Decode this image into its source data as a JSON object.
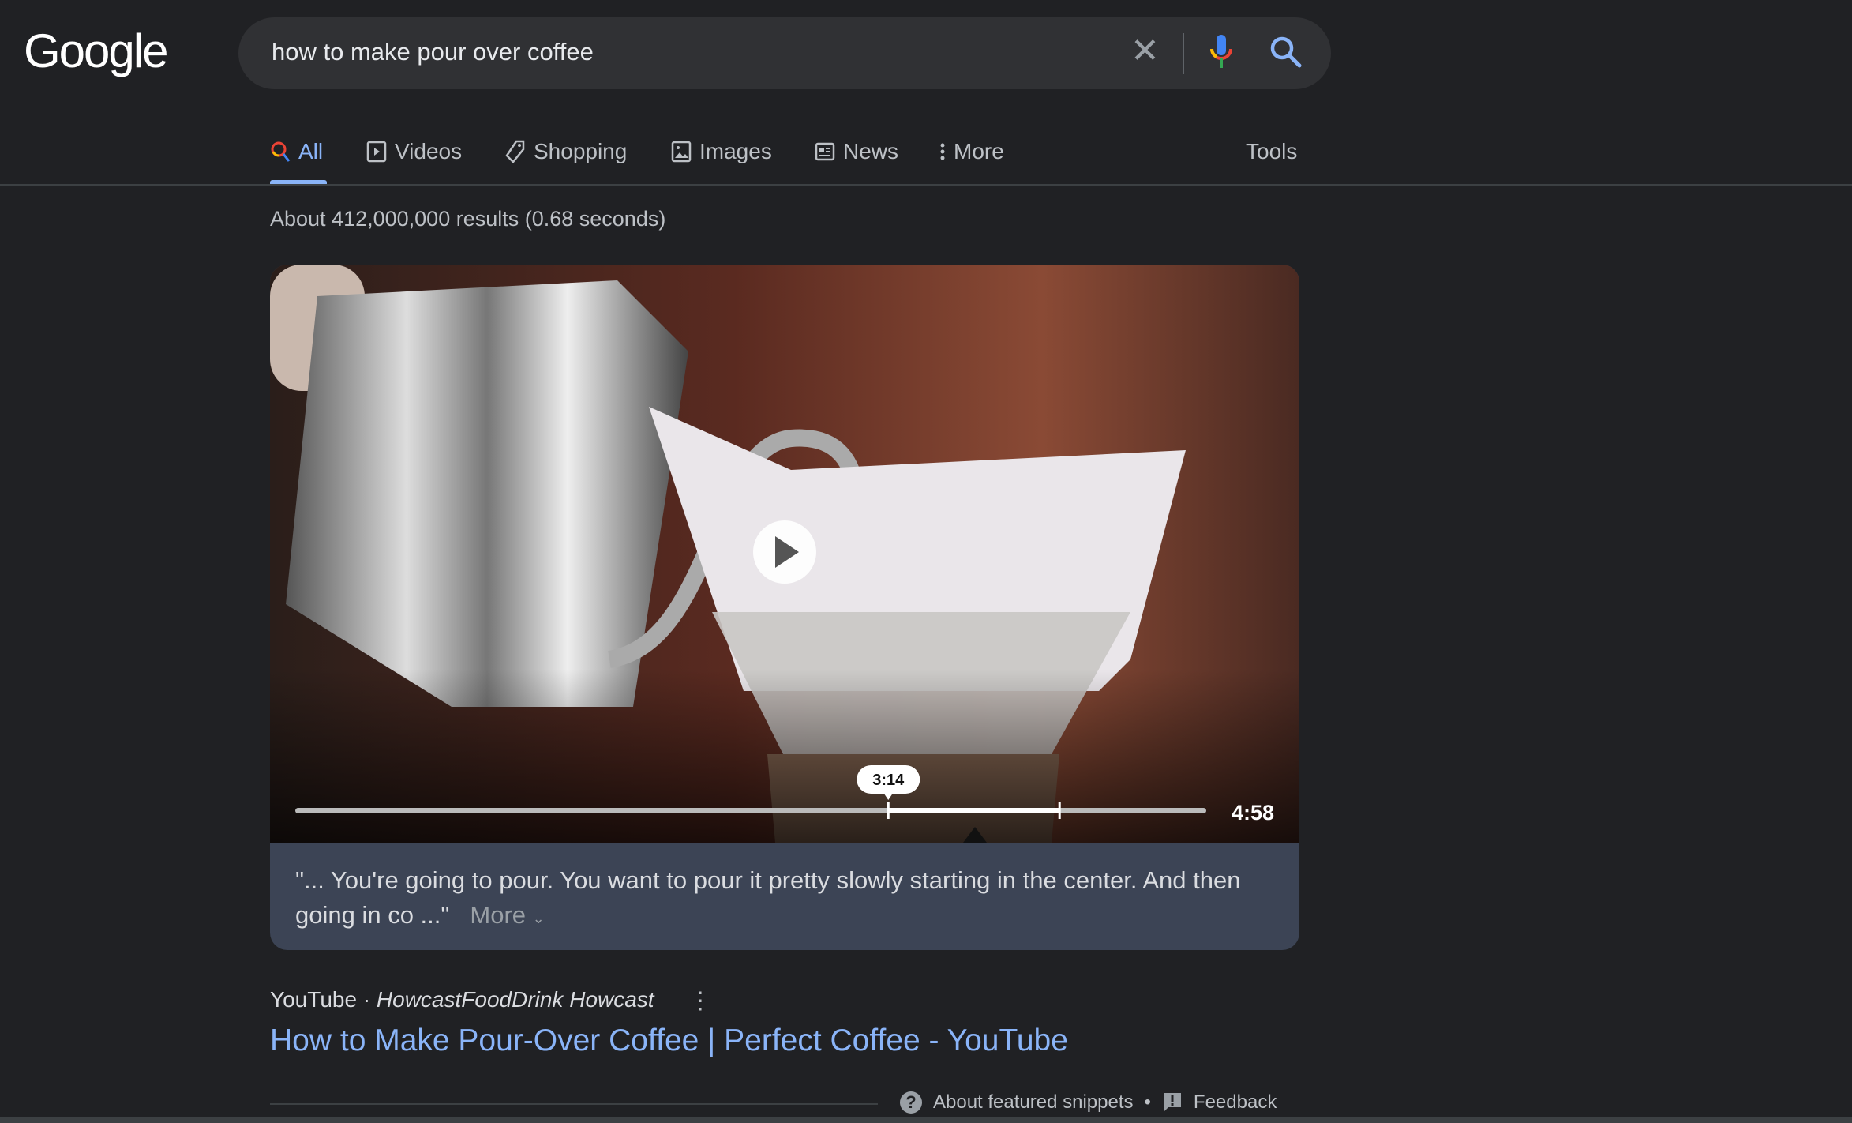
{
  "logo": "Google",
  "search": {
    "query": "how to make pour over coffee",
    "clear_icon": "close-icon",
    "mic_icon": "mic-icon",
    "search_icon": "search-icon"
  },
  "tabs": [
    {
      "label": "All",
      "active": true,
      "icon": "search-icon"
    },
    {
      "label": "Videos",
      "icon": "play-box-icon"
    },
    {
      "label": "Shopping",
      "icon": "tag-icon"
    },
    {
      "label": "Images",
      "icon": "image-icon"
    },
    {
      "label": "News",
      "icon": "newspaper-icon"
    },
    {
      "label": "More",
      "icon": "dots-vertical-icon"
    }
  ],
  "tools": "Tools",
  "result_count": "About 412,000,000 results (0.68 seconds)",
  "video": {
    "marker_time": "3:14",
    "duration": "4:58",
    "progress": {
      "clip_start_fraction": 0.651,
      "clip_end_fraction": 0.839
    }
  },
  "caption": {
    "text": "\"... You're going to pour. You want to pour it pretty slowly starting in the center. And then going in co ...\"",
    "more": "More"
  },
  "source": {
    "site": "YouTube",
    "separator": " · ",
    "channel": "HowcastFoodDrink Howcast"
  },
  "title": "How to Make Pour-Over Coffee | Perfect Coffee - YouTube",
  "footer": {
    "about": "About featured snippets",
    "dot": "•",
    "feedback": "Feedback"
  },
  "colors": {
    "background": "#202124",
    "link": "#8ab4f8",
    "caption_bg": "#3c4455"
  }
}
